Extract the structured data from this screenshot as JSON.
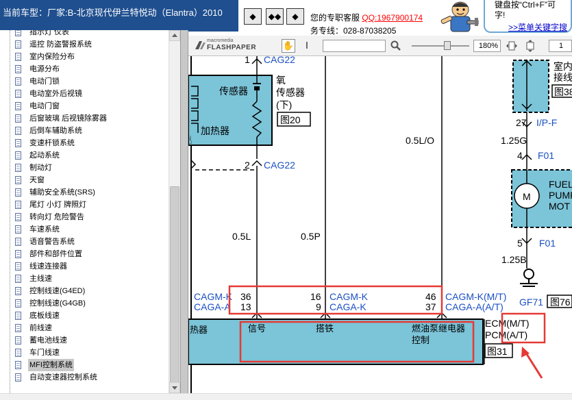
{
  "header": {
    "car_title": "当前车型：厂家:B-北京现代伊兰特悦动（Elantra）2010",
    "nav_buttons": [
      "◆",
      "◆◆",
      "◆"
    ],
    "contact_prefix": "您的专职客服",
    "qq": "QQ:1967900174",
    "service_line": "务专线：028-87038205",
    "tip_line1": "键盘按“Ctrl+F”可",
    "tip_line2": "字!",
    "tip_link": ">>菜单关键字搜"
  },
  "tree": {
    "items": [
      "指示灯 仪表",
      "遥控 防盗警报系统",
      "室内保险分布",
      "电源分布",
      "电动门锁",
      "电动室外后视镜",
      "电动门窗",
      "后窗玻璃 后视镜除雾器",
      "后倒车辅助系统",
      "变速杆锁系统",
      "起动系统",
      "制动灯",
      "天窗",
      "辅助安全系统(SRS)",
      "尾灯 小灯 牌照灯",
      "转向灯 危险警告",
      "车速系统",
      "语音警告系统",
      "部件和部件位置",
      "线速连接器",
      "主线速",
      "控制线速(G4ED)",
      "控制线速(G4GB)",
      "底板线速",
      "前线速",
      "蓄电池线速",
      "车门线速",
      "MFI控制系统",
      "自动变速器控制系统"
    ],
    "selected": "MFI控制系统"
  },
  "viewer": {
    "brand_small": "macromedia",
    "brand": "FLASHPAPER",
    "search_value": "",
    "zoom": "180%",
    "page": "1"
  },
  "diagram": {
    "o2_pin_top": "1",
    "o2_conn_top": "CAG22",
    "sensor_label": "传感器",
    "heater_label": "加热器",
    "o2_label_1": "氧",
    "o2_label_2": "传感器",
    "o2_label_3": "(下)",
    "fig20": "图20",
    "o2_pin_bottom": "2",
    "o2_conn_bottom": "CAG22",
    "wire_05lo": "0.5L/O",
    "wire_05l": "0.5L",
    "wire_05p": "0.5P",
    "conn_left_1": "CAGM-K",
    "conn_left_2": "CAGA-A",
    "pin_36": "36",
    "pin_13": "13",
    "pin_16": "16",
    "pin_9": "9",
    "conn_mid_1": "CAGM-K",
    "conn_mid_2": "CAGA-K",
    "pin_46": "46",
    "pin_37": "37",
    "conn_right_1": "CAGM-K(M/T)",
    "conn_right_2": "CAGA-A(A/T)",
    "ecm_left": "热器",
    "ecm_signal": "信号",
    "ecm_ground": "搭铁",
    "ecm_relay_1": "燃油泵继电器",
    "ecm_relay_2": "控制",
    "ecm_1": "ECM(M/T)",
    "ecm_2": "PCM(A/T)",
    "fig31": "图31",
    "room_1": "室内",
    "room_2": "接线",
    "fig38": "图38",
    "pin_27": "27",
    "ipf": "I/P-F",
    "wire_125g": "1.25G",
    "pin_4": "4",
    "f01_a": "F01",
    "pump_1": "FUEL",
    "pump_2": "PUMP",
    "pump_3": "MOT",
    "motor": "M",
    "pin_5": "5",
    "f01_b": "F01",
    "wire_125b": "1.25B",
    "gf71": "GF71",
    "fig76": "图76"
  },
  "colors": {
    "title_bg": "#1f4f8f",
    "component_fill": "#7cc4d8",
    "connector_blue": "#1a4fc4",
    "annotation_red": "#e53935"
  }
}
